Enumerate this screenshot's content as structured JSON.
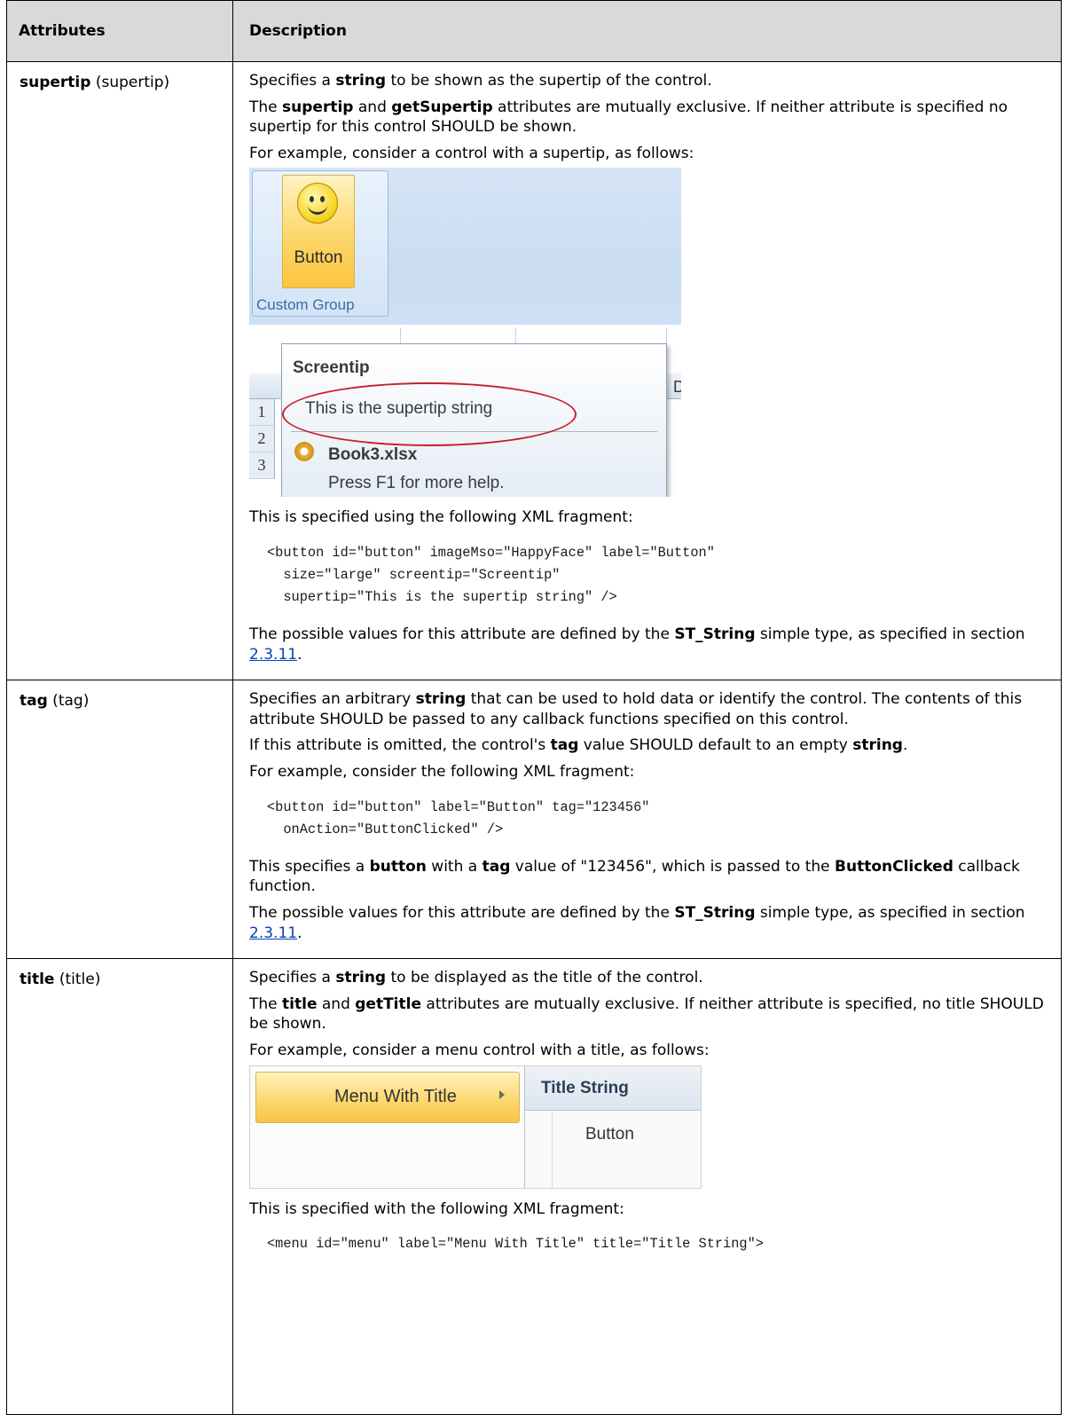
{
  "table": {
    "headers": [
      "Attributes",
      "Description"
    ],
    "rows": [
      {
        "name_bold": "supertip",
        "name_rest": " (supertip)",
        "p1": [
          "Specifies a ",
          "string",
          " to be shown as the supertip of the control."
        ],
        "p2": [
          "The ",
          "supertip",
          " and ",
          "getSupertip",
          " attributes are mutually exclusive. If neither attribute is specified no supertip for this control SHOULD be shown."
        ],
        "p3": "For example, consider a control with a supertip, as follows:",
        "figure": {
          "button_label": "Button",
          "group_label": "Custom Group",
          "tip_title": "Screentip",
          "tip_text": "This is the supertip string",
          "tip_file": "Book3.xlsx",
          "tip_help": "Press F1 for more help.",
          "row_numbers": [
            "1",
            "2",
            "3"
          ],
          "col_letter": "D"
        },
        "p4": "This is specified using the following XML fragment:",
        "code": "<button id=\"button\" imageMso=\"HappyFace\" label=\"Button\"\n  size=\"large\" screentip=\"Screentip\"\n  supertip=\"This is the supertip string\" />",
        "p5": [
          "The possible values for this attribute are defined by the ",
          "ST_String",
          " simple type, as specified in section ",
          "2.3.11",
          "."
        ]
      },
      {
        "name_bold": "tag",
        "name_rest": " (tag)",
        "p1": [
          "Specifies an arbitrary ",
          "string",
          " that can be used to hold data or identify the control. The contents of this attribute SHOULD be passed to any callback functions specified on this control."
        ],
        "p2": [
          "If this attribute is omitted, the control's ",
          "tag",
          " value SHOULD default to an empty ",
          "string",
          "."
        ],
        "p3": "For example, consider the following XML fragment:",
        "code": "<button id=\"button\" label=\"Button\" tag=\"123456\"\n  onAction=\"ButtonClicked\" />",
        "p4": [
          "This specifies a ",
          "button",
          " with a ",
          "tag",
          " value of \"123456\", which is passed to the ",
          "ButtonClicked",
          " callback function."
        ],
        "p5": [
          "The possible values for this attribute are defined by the ",
          "ST_String",
          " simple type, as specified in section ",
          "2.3.11",
          "."
        ]
      },
      {
        "name_bold": "title",
        "name_rest": " (title)",
        "p1": [
          "Specifies a ",
          "string",
          " to be displayed as the title of the control."
        ],
        "p2": [
          "The ",
          "title",
          " and ",
          "getTitle",
          " attributes are mutually exclusive. If neither attribute is specified, no title SHOULD be shown."
        ],
        "p3": "For example, consider a menu control with a title, as follows:",
        "figure": {
          "menu_label": "Menu With Title",
          "title_string": "Title String",
          "button_label": "Button"
        },
        "p4": "This is specified with the following XML fragment:",
        "code": "<menu id=\"menu\" label=\"Menu With Title\" title=\"Title String\">"
      }
    ]
  }
}
